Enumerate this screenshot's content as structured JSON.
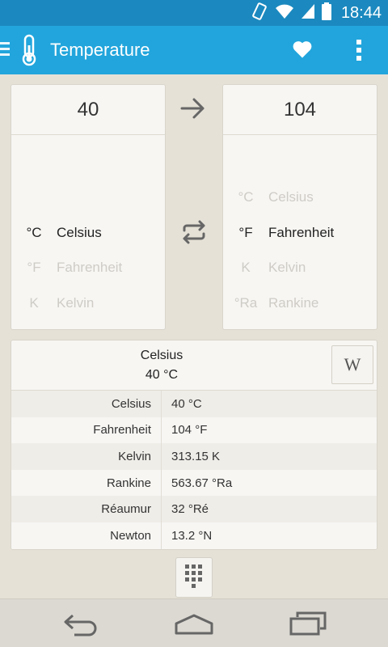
{
  "status_bar": {
    "time": "18:44"
  },
  "app_bar": {
    "title": "Temperature"
  },
  "from": {
    "value": "40",
    "units": [
      {
        "symbol": "°C",
        "name": "Celsius",
        "state": "selected"
      },
      {
        "symbol": "°F",
        "name": "Fahrenheit",
        "state": "faded"
      },
      {
        "symbol": "K",
        "name": "Kelvin",
        "state": "faded"
      }
    ]
  },
  "to": {
    "value": "104",
    "units": [
      {
        "symbol": "°C",
        "name": "Celsius",
        "state": "faded"
      },
      {
        "symbol": "°F",
        "name": "Fahrenheit",
        "state": "selected"
      },
      {
        "symbol": "K",
        "name": "Kelvin",
        "state": "faded"
      },
      {
        "symbol": "°Ra",
        "name": "Rankine",
        "state": "faded"
      }
    ]
  },
  "info": {
    "name": "Celsius",
    "value": "40 °C",
    "wiki_label": "W",
    "conversions": [
      {
        "unit": "Celsius",
        "value": "40 °C"
      },
      {
        "unit": "Fahrenheit",
        "value": "104 °F"
      },
      {
        "unit": "Kelvin",
        "value": "313.15 K"
      },
      {
        "unit": "Rankine",
        "value": "563.67 °Ra"
      },
      {
        "unit": "Réaumur",
        "value": "32 °Ré"
      },
      {
        "unit": "Newton",
        "value": "13.2 °N"
      }
    ]
  },
  "colors": {
    "status_bar": "#1b89bf",
    "app_bar": "#22a5dc",
    "background": "#e5e1d7",
    "card": "#f7f6f3"
  },
  "icons": {
    "app": "thermometer-icon",
    "favorite": "heart-icon",
    "overflow": "overflow-menu-icon",
    "convert": "arrow-right-icon",
    "swap": "swap-icon",
    "keypad": "keypad-icon"
  }
}
